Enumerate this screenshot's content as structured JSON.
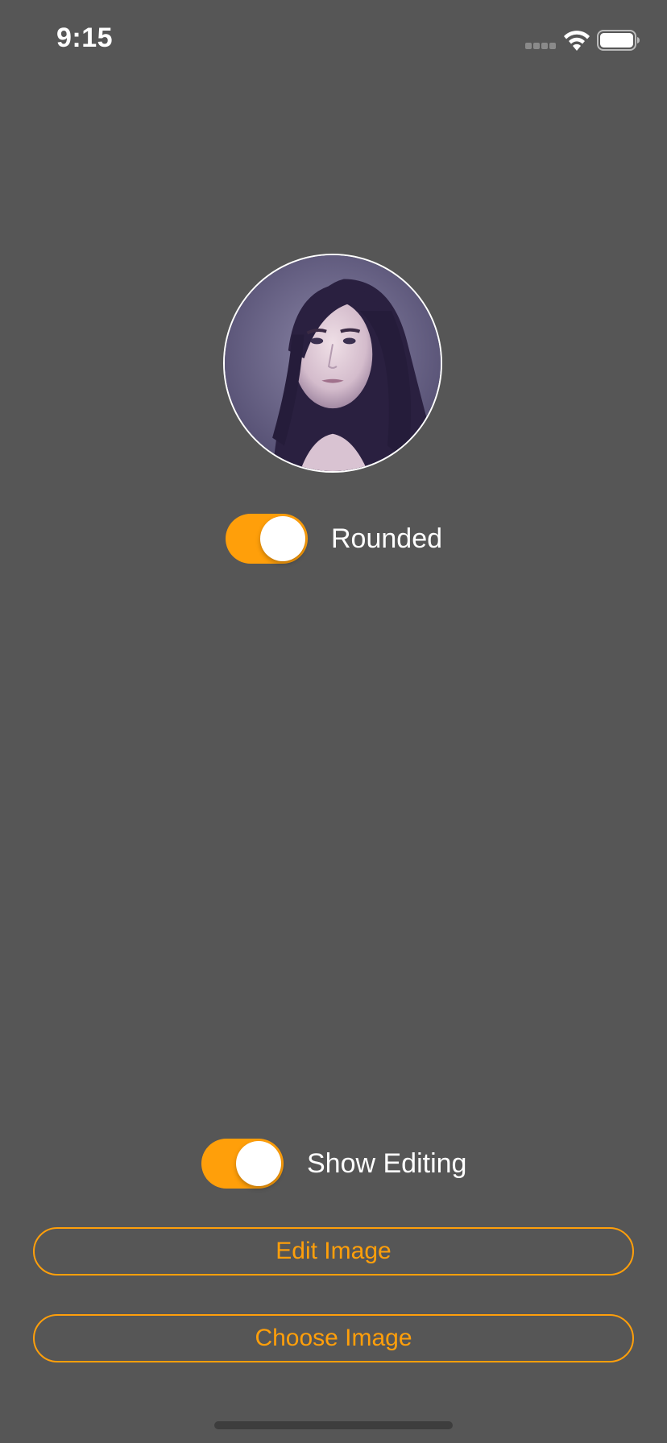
{
  "status_bar": {
    "time": "9:15",
    "icons": [
      "signal-icon",
      "wifi-icon",
      "battery-icon"
    ]
  },
  "avatar": {
    "shape": "circle",
    "border_color": "#ffffff"
  },
  "toggles": {
    "rounded": {
      "label": "Rounded",
      "on": true
    },
    "show_editing": {
      "label": "Show Editing",
      "on": true
    }
  },
  "buttons": {
    "edit_image": "Edit Image",
    "choose_image": "Choose Image"
  },
  "colors": {
    "background": "#565656",
    "accent": "#ff9f0a",
    "text": "#ffffff"
  }
}
